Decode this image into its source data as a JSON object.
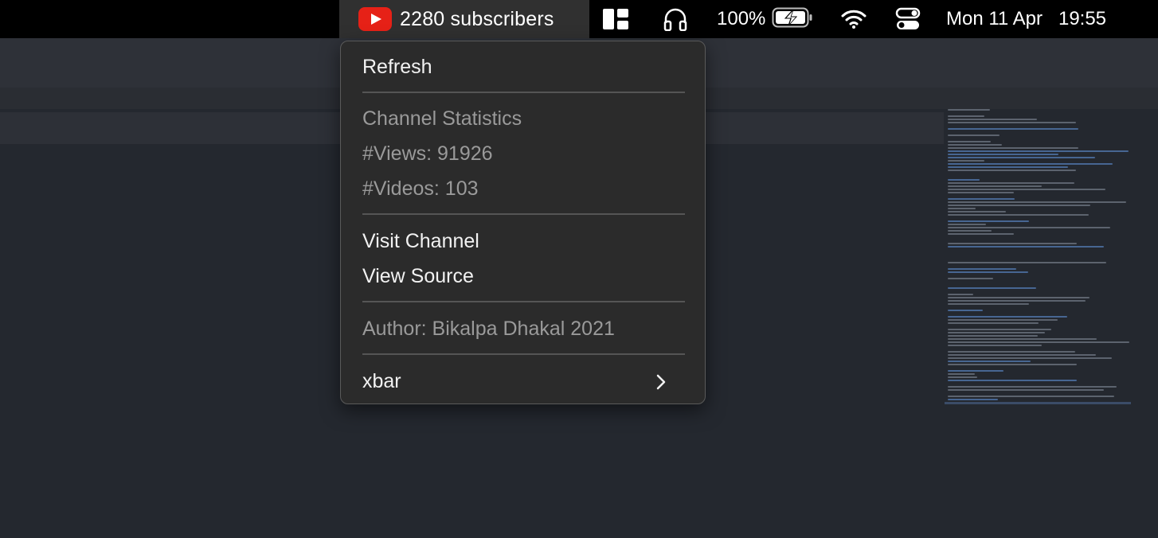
{
  "menubar": {
    "youtube": {
      "subscribers_label": "2280 subscribers"
    },
    "battery_percent": "100%",
    "date": "Mon 11 Apr",
    "time": "19:55",
    "icons": [
      "youtube-logo-icon",
      "layout-grid-icon",
      "headphones-icon",
      "battery-charging-icon",
      "wifi-icon",
      "control-center-icon"
    ]
  },
  "menu": {
    "refresh": "Refresh",
    "stats_heading": "Channel Statistics",
    "views": "#Views: 91926",
    "videos": "#Videos: 103",
    "visit_channel": "Visit Channel",
    "view_source": "View Source",
    "author": "Author: Bikalpa Dhakal 2021",
    "xbar": "xbar"
  },
  "colors": {
    "menubar_bg": "#000000",
    "menu_bg": "#2b2b2b",
    "youtube_red": "#e62117",
    "disabled_text": "#9a9a9a"
  }
}
